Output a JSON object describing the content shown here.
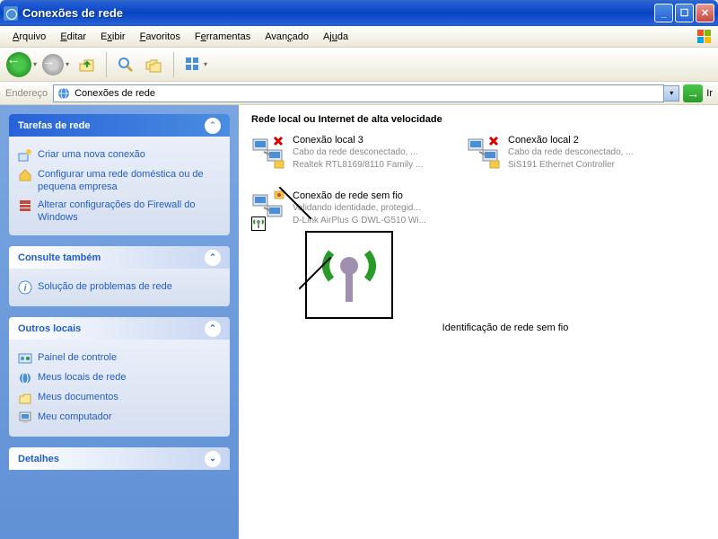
{
  "title": "Conexões de rede",
  "menu": {
    "arquivo": "Arquivo",
    "editar": "Editar",
    "exibir": "Exibir",
    "favoritos": "Favoritos",
    "ferramentas": "Ferramentas",
    "avancado": "Avançado",
    "ajuda": "Ajuda"
  },
  "address": {
    "label": "Endereço",
    "value": "Conexões de rede",
    "go": "Ir"
  },
  "sidebar": {
    "tasks": {
      "title": "Tarefas de rede",
      "items": [
        "Criar uma nova conexão",
        "Configurar uma rede doméstica ou de pequena empresa",
        "Alterar configurações do Firewall do Windows"
      ]
    },
    "seealso": {
      "title": "Consulte também",
      "items": [
        "Solução de problemas de rede"
      ]
    },
    "other": {
      "title": "Outros locais",
      "items": [
        "Painel de controle",
        "Meus locais de rede",
        "Meus documentos",
        "Meu computador"
      ]
    },
    "details": {
      "title": "Detalhes"
    }
  },
  "content": {
    "section": "Rede local ou Internet de alta velocidade",
    "connections": [
      {
        "name": "Conexão local 3",
        "status": "Cabo da rede desconectado, ...",
        "device": "Realtek RTL8169/8110 Family ..."
      },
      {
        "name": "Conexão local 2",
        "status": "Cabo da rede desconectado, ...",
        "device": "SiS191 Ethernet Controller"
      },
      {
        "name": "Conexão de rede sem fio",
        "status": "Validando identidade, protegid...",
        "device": "D-Link AirPlus G DWL-G510 Wi..."
      }
    ],
    "zoom_label": "Identificação de rede sem fio"
  }
}
